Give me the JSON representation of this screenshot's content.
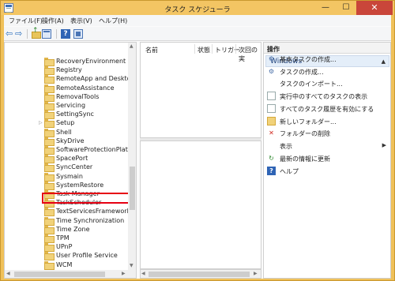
{
  "window": {
    "title": "タスク スケジューラ",
    "controls": {
      "minimize": "—",
      "maximize": "☐",
      "close": "✕"
    }
  },
  "menu": [
    {
      "label": "ファイル(F)"
    },
    {
      "label": "操作(A)"
    },
    {
      "label": "表示(V)"
    },
    {
      "label": "ヘルプ(H)"
    }
  ],
  "toolbar": {
    "back": "⇦",
    "forward": "⇨",
    "help": "?"
  },
  "tree": {
    "items": [
      "RecoveryEnvironment",
      "Registry",
      "RemoteApp and Desktop",
      "RemoteAssistance",
      "RemovalTools",
      "Servicing",
      "SettingSync",
      "Setup",
      "Shell",
      "SkyDrive",
      "SoftwareProtectionPlatfo",
      "SpacePort",
      "SyncCenter",
      "Sysmain",
      "SystemRestore",
      "Task Manager",
      "TaskScheduler",
      "TextServicesFramework",
      "Time Synchronization",
      "Time Zone",
      "TPM",
      "UPnP",
      "User Profile Service",
      "WCM"
    ],
    "selected": "TextServicesFramework",
    "expander": "▷"
  },
  "task_list": {
    "columns": [
      "名前",
      "状態",
      "トリガー",
      "次回の実"
    ]
  },
  "actions": {
    "header": "操作",
    "section": "Windows",
    "section_arrow": "▲",
    "items": [
      {
        "label": "基本タスクの作成...",
        "icon": "basic-task-icon"
      },
      {
        "label": "タスクの作成...",
        "icon": "create-task-icon"
      },
      {
        "label": "タスクのインポート...",
        "icon": "none"
      },
      {
        "label": "実行中のすべてのタスクの表示",
        "icon": "running-tasks-icon"
      },
      {
        "label": "すべてのタスク履歴を有効にする",
        "icon": "history-icon"
      },
      {
        "label": "新しいフォルダー...",
        "icon": "new-folder-icon"
      },
      {
        "label": "フォルダーの削除",
        "icon": "delete-icon"
      },
      {
        "label": "表示",
        "icon": "none",
        "submenu": "▶"
      },
      {
        "label": "最新の情報に更新",
        "icon": "refresh-icon"
      },
      {
        "label": "ヘルプ",
        "icon": "help-icon"
      }
    ]
  },
  "colors": {
    "titlebar": "#f3c563",
    "highlight_box": "#e60012",
    "section_header": "#e4eef9"
  }
}
